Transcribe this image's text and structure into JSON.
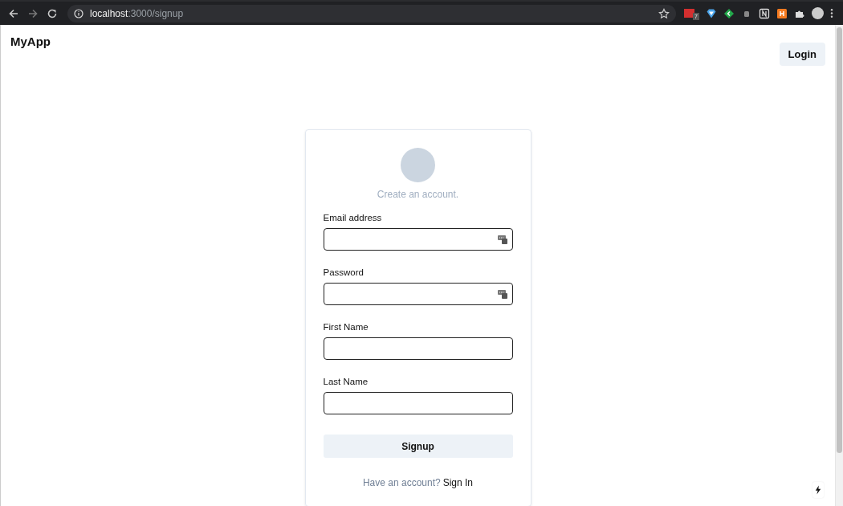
{
  "browser": {
    "url_host": "localhost",
    "url_path": ":3000/signup",
    "extension_badge": "7"
  },
  "navbar": {
    "brand": "MyApp",
    "login_button": "Login"
  },
  "form": {
    "subtitle": "Create an account.",
    "fields": [
      {
        "label": "Email address",
        "autofill_icon": true
      },
      {
        "label": "Password",
        "autofill_icon": true
      },
      {
        "label": "First Name",
        "autofill_icon": false
      },
      {
        "label": "Last Name",
        "autofill_icon": false
      }
    ],
    "submit_button": "Signup",
    "footer": {
      "prompt": "Have an account?",
      "link": "Sign In"
    }
  }
}
